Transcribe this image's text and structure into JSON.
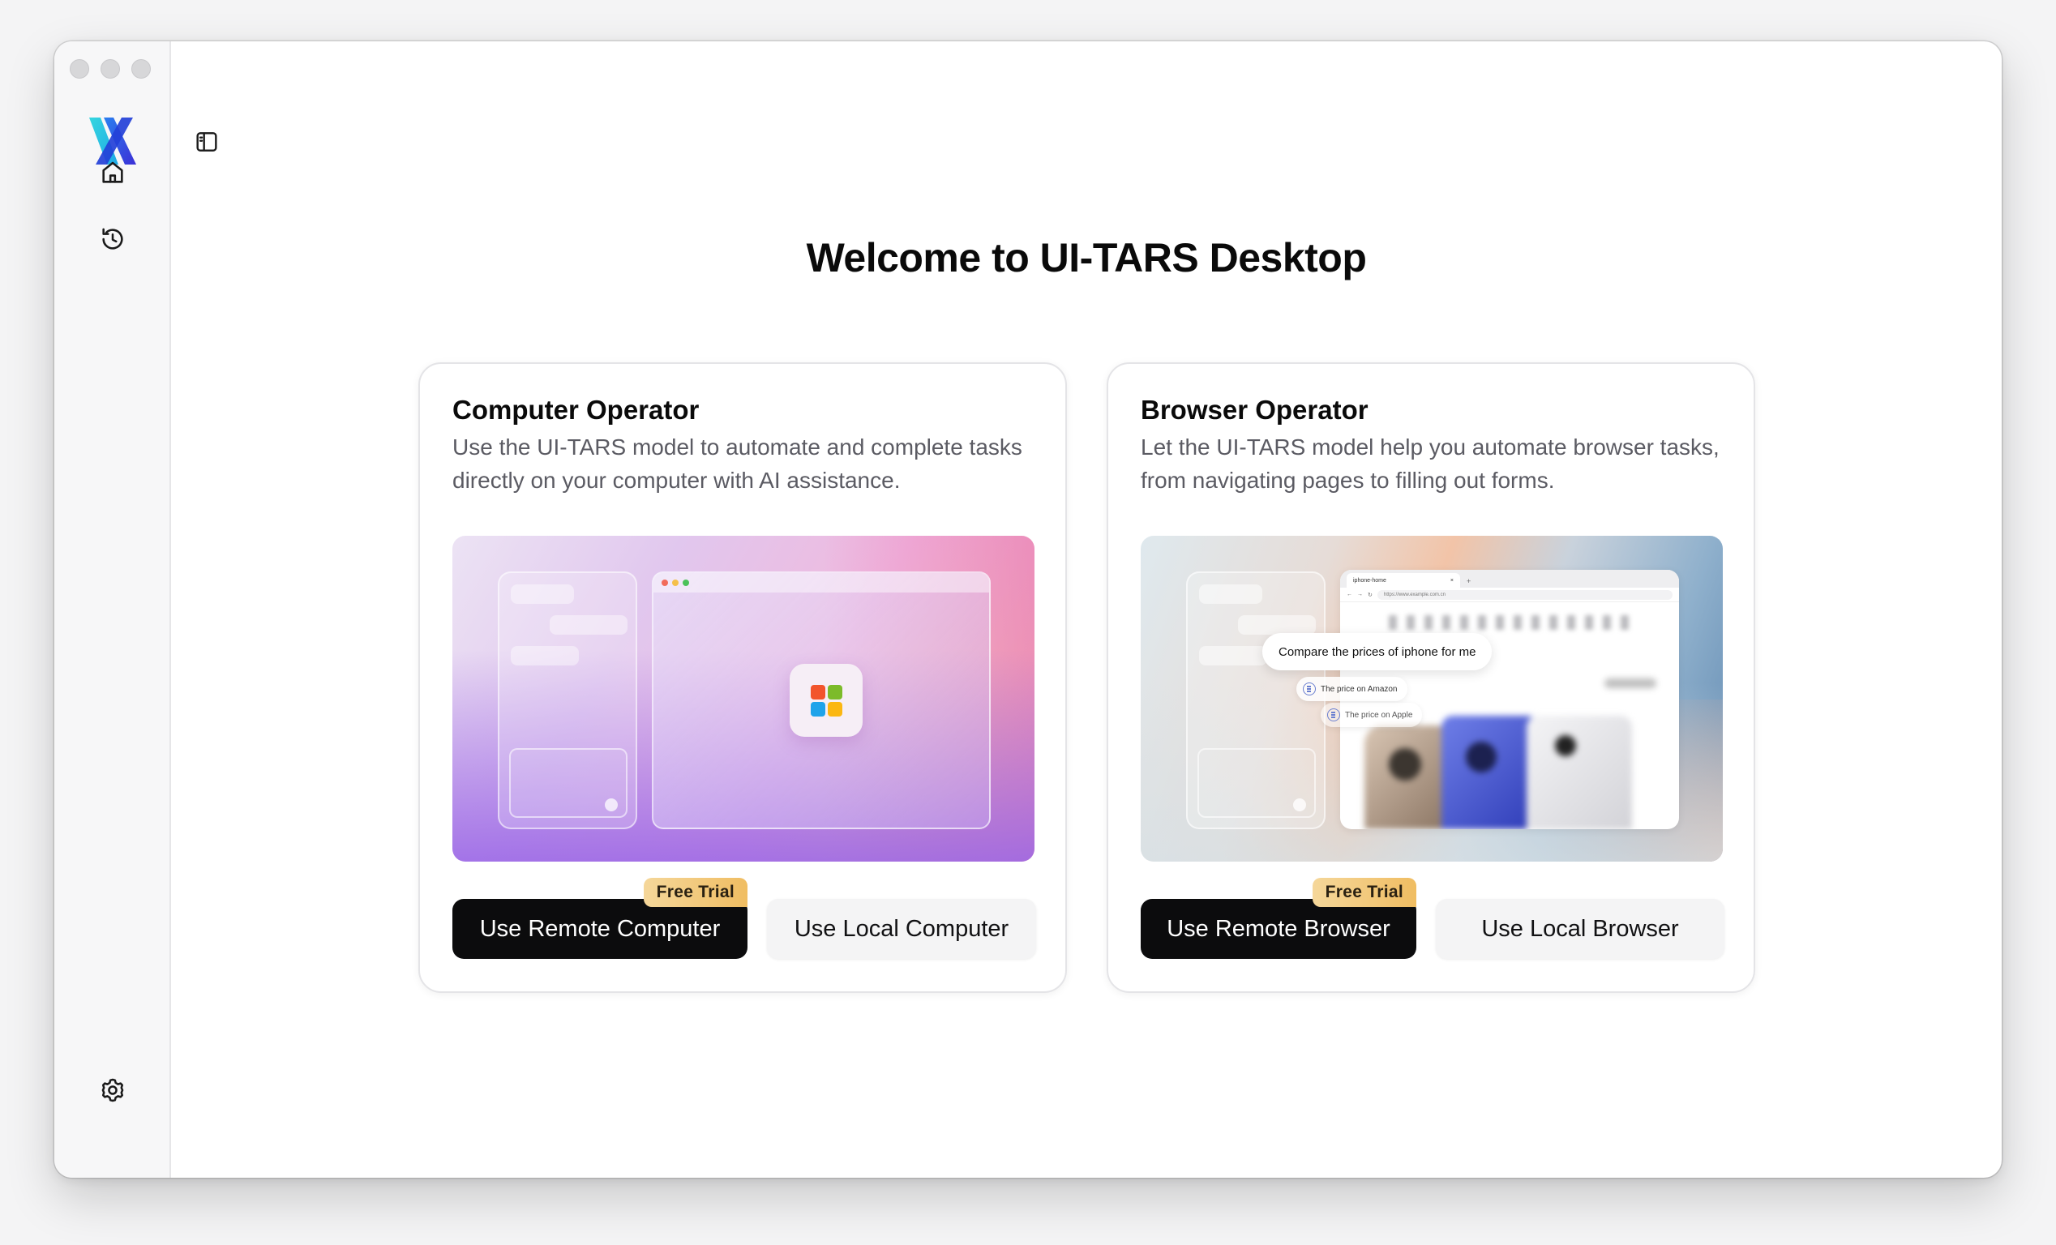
{
  "app": {
    "title": "Welcome to UI-TARS Desktop"
  },
  "sidebar": {
    "items": [
      {
        "name": "home",
        "icon": "home-icon"
      },
      {
        "name": "history",
        "icon": "history-icon"
      },
      {
        "name": "settings",
        "icon": "gear-icon"
      }
    ],
    "toggle_icon": "sidebar-toggle-icon"
  },
  "cards": {
    "computer": {
      "title": "Computer Operator",
      "description": "Use the UI-TARS model to automate and complete tasks directly on your computer with AI assistance.",
      "remote_button": "Use Remote Computer",
      "badge": "Free Trial",
      "local_button": "Use Local Computer"
    },
    "browser": {
      "title": "Browser Operator",
      "description": "Let the UI-TARS model help you automate browser tasks, from navigating pages to filling out forms.",
      "remote_button": "Use Remote Browser",
      "badge": "Free Trial",
      "local_button": "Use Local Browser",
      "preview": {
        "tab_label": "iphone-home",
        "url": "https://www.example.com.cn",
        "chat_main": "Compare the prices of iphone for me",
        "chat_amazon": "The price on Amazon",
        "chat_apple": "The price on Apple"
      }
    }
  },
  "colors": {
    "accent_dark": "#0c0c0d",
    "badge": "#f0bd62",
    "logo_cyan": "#2ec9e0",
    "logo_blue": "#2f46d9"
  }
}
